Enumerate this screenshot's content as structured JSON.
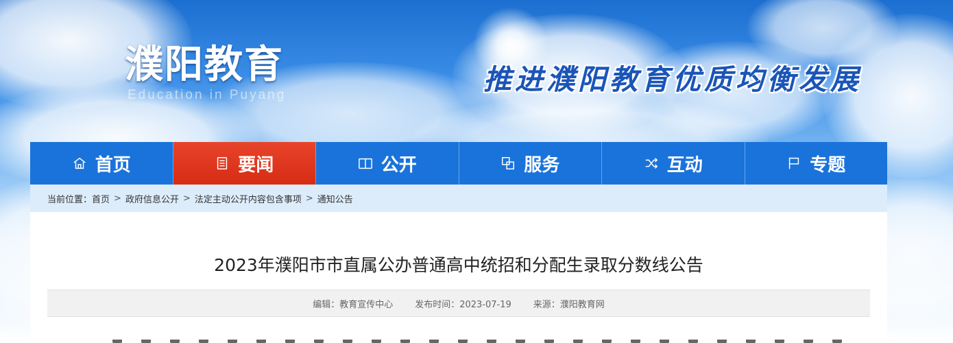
{
  "header": {
    "logo_text": "濮阳教育",
    "logo_subtext": "Education in Puyang",
    "slogan": "推进濮阳教育优质均衡发展"
  },
  "nav": {
    "items": [
      {
        "label": "首页",
        "icon": "home-icon"
      },
      {
        "label": "要闻",
        "icon": "news-icon"
      },
      {
        "label": "公开",
        "icon": "book-icon"
      },
      {
        "label": "服务",
        "icon": "service-icon"
      },
      {
        "label": "互动",
        "icon": "shuffle-icon"
      },
      {
        "label": "专题",
        "icon": "flag-icon"
      }
    ],
    "active_index": 1
  },
  "breadcrumb": {
    "prefix": "当前位置：",
    "items": [
      "首页",
      "政府信息公开",
      "法定主动公开内容包含事项",
      "通知公告"
    ],
    "separator": ">"
  },
  "article": {
    "title": "2023年濮阳市市直属公办普通高中统招和分配生录取分数线公告",
    "meta": {
      "editor": "编辑：教育宣传中心",
      "published": "发布时间：2023-07-19",
      "source": "来源：濮阳教育网"
    }
  },
  "colors": {
    "nav_bg": "#1a73db",
    "nav_active": "#d62c14",
    "breadcrumb_bg": "#dcecfb"
  }
}
